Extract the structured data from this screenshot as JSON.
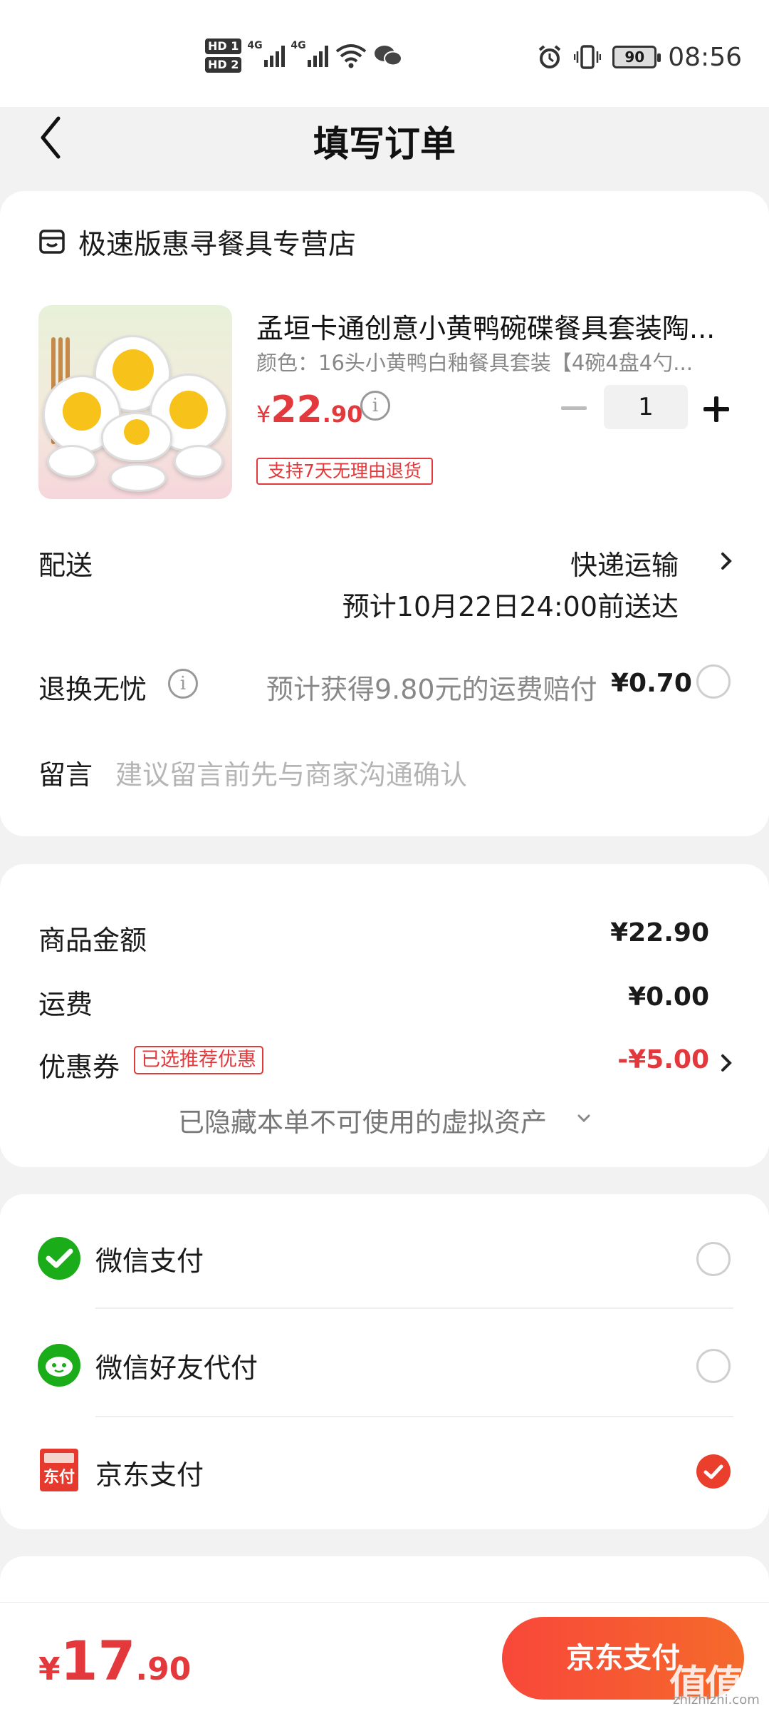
{
  "status_bar": {
    "hd1": "HD 1",
    "hd2": "HD 2",
    "net1": "4G",
    "net2": "4G",
    "battery": "90",
    "time": "08:56"
  },
  "header": {
    "title": "填写订单"
  },
  "store": {
    "name": "极速版惠寻餐具专营店"
  },
  "product": {
    "title": "孟垣卡通创意小黄鸭碗碟餐具套装陶...",
    "spec": "颜色：16头小黄鸭白釉餐具套装【4碗4盘4勺...",
    "price_symbol": "¥",
    "price_int": "22",
    "price_dec": ".90",
    "quantity": "1",
    "return_tag": "支持7天无理由退货"
  },
  "delivery": {
    "label": "配送",
    "method": "快递运输",
    "eta": "预计10月22日24:00前送达"
  },
  "return_worry": {
    "label": "退换无忧",
    "desc": "预计获得9.80元的运费赔付",
    "price": "¥0.70"
  },
  "message": {
    "label": "留言",
    "placeholder": "建议留言前先与商家沟通确认"
  },
  "summary": {
    "goods_label": "商品金额",
    "goods_value": "¥22.90",
    "shipping_label": "运费",
    "shipping_value": "¥0.00",
    "coupon_label": "优惠券",
    "coupon_tag": "已选推荐优惠",
    "coupon_value": "-¥5.00",
    "hidden_assets": "已隐藏本单不可使用的虚拟资产"
  },
  "payment": {
    "options": [
      {
        "label": "微信支付",
        "selected": false
      },
      {
        "label": "微信好友代付",
        "selected": false
      },
      {
        "label": "京东支付",
        "selected": true
      }
    ],
    "jd_icon_text": "东付"
  },
  "footer": {
    "total_symbol": "¥",
    "total_int": "17",
    "total_dec": ".90",
    "pay_button": "京东支付",
    "watermark": "值值值",
    "watermark_url": "zhizhizhi.com"
  },
  "colors": {
    "accent_red": "#e4393c",
    "wechat_green": "#1aad19",
    "pay_button_start": "#f8473a",
    "pay_button_end": "#f56a2b"
  }
}
